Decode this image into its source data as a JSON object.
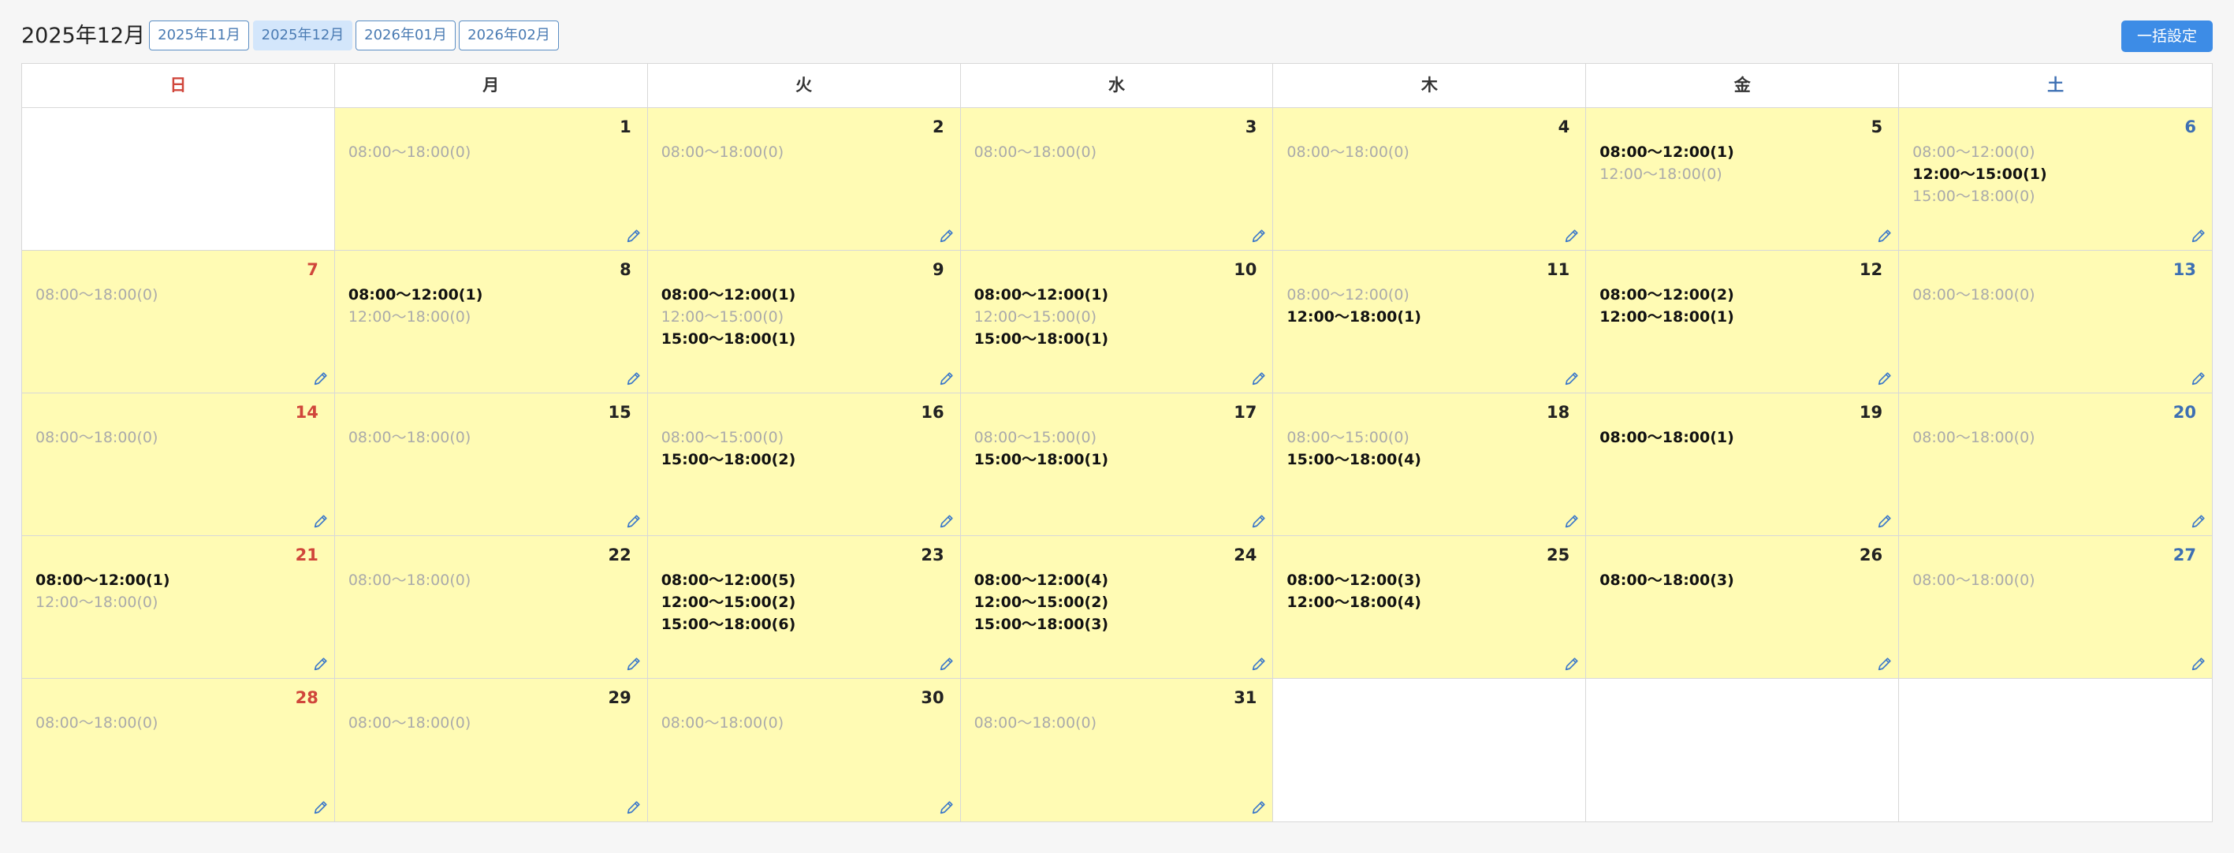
{
  "header": {
    "title": "2025年12月",
    "months": [
      {
        "label": "2025年11月",
        "active": false
      },
      {
        "label": "2025年12月",
        "active": true
      },
      {
        "label": "2026年01月",
        "active": false
      },
      {
        "label": "2026年02月",
        "active": false
      }
    ],
    "bulk_label": "一括設定"
  },
  "colors": {
    "sunday": "#d0463b",
    "saturday": "#3d6fb3",
    "active_day": "#fffbb4",
    "accent": "#3d8ce6",
    "unavailable": "#aaaaaa"
  },
  "weekdays": [
    "日",
    "月",
    "火",
    "水",
    "木",
    "金",
    "土"
  ],
  "leading_blanks": 1,
  "trailing_blanks": 3,
  "days": [
    {
      "day": "1",
      "slots": [
        {
          "text": "08:00〜18:00(0)",
          "on": false
        }
      ]
    },
    {
      "day": "2",
      "slots": [
        {
          "text": "08:00〜18:00(0)",
          "on": false
        }
      ]
    },
    {
      "day": "3",
      "slots": [
        {
          "text": "08:00〜18:00(0)",
          "on": false
        }
      ]
    },
    {
      "day": "4",
      "slots": [
        {
          "text": "08:00〜18:00(0)",
          "on": false
        }
      ]
    },
    {
      "day": "5",
      "slots": [
        {
          "text": "08:00〜12:00(1)",
          "on": true
        },
        {
          "text": "12:00〜18:00(0)",
          "on": false
        }
      ]
    },
    {
      "day": "6",
      "slots": [
        {
          "text": "08:00〜12:00(0)",
          "on": false
        },
        {
          "text": "12:00〜15:00(1)",
          "on": true
        },
        {
          "text": "15:00〜18:00(0)",
          "on": false
        }
      ]
    },
    {
      "day": "7",
      "slots": [
        {
          "text": "08:00〜18:00(0)",
          "on": false
        }
      ]
    },
    {
      "day": "8",
      "slots": [
        {
          "text": "08:00〜12:00(1)",
          "on": true
        },
        {
          "text": "12:00〜18:00(0)",
          "on": false
        }
      ]
    },
    {
      "day": "9",
      "slots": [
        {
          "text": "08:00〜12:00(1)",
          "on": true
        },
        {
          "text": "12:00〜15:00(0)",
          "on": false
        },
        {
          "text": "15:00〜18:00(1)",
          "on": true
        }
      ]
    },
    {
      "day": "10",
      "slots": [
        {
          "text": "08:00〜12:00(1)",
          "on": true
        },
        {
          "text": "12:00〜15:00(0)",
          "on": false
        },
        {
          "text": "15:00〜18:00(1)",
          "on": true
        }
      ]
    },
    {
      "day": "11",
      "slots": [
        {
          "text": "08:00〜12:00(0)",
          "on": false
        },
        {
          "text": "12:00〜18:00(1)",
          "on": true
        }
      ]
    },
    {
      "day": "12",
      "slots": [
        {
          "text": "08:00〜12:00(2)",
          "on": true
        },
        {
          "text": "12:00〜18:00(1)",
          "on": true
        }
      ]
    },
    {
      "day": "13",
      "slots": [
        {
          "text": "08:00〜18:00(0)",
          "on": false
        }
      ]
    },
    {
      "day": "14",
      "slots": [
        {
          "text": "08:00〜18:00(0)",
          "on": false
        }
      ]
    },
    {
      "day": "15",
      "slots": [
        {
          "text": "08:00〜18:00(0)",
          "on": false
        }
      ]
    },
    {
      "day": "16",
      "slots": [
        {
          "text": "08:00〜15:00(0)",
          "on": false
        },
        {
          "text": "15:00〜18:00(2)",
          "on": true
        }
      ]
    },
    {
      "day": "17",
      "slots": [
        {
          "text": "08:00〜15:00(0)",
          "on": false
        },
        {
          "text": "15:00〜18:00(1)",
          "on": true
        }
      ]
    },
    {
      "day": "18",
      "slots": [
        {
          "text": "08:00〜15:00(0)",
          "on": false
        },
        {
          "text": "15:00〜18:00(4)",
          "on": true
        }
      ]
    },
    {
      "day": "19",
      "slots": [
        {
          "text": "08:00〜18:00(1)",
          "on": true
        }
      ]
    },
    {
      "day": "20",
      "slots": [
        {
          "text": "08:00〜18:00(0)",
          "on": false
        }
      ]
    },
    {
      "day": "21",
      "slots": [
        {
          "text": "08:00〜12:00(1)",
          "on": true
        },
        {
          "text": "12:00〜18:00(0)",
          "on": false
        }
      ]
    },
    {
      "day": "22",
      "slots": [
        {
          "text": "08:00〜18:00(0)",
          "on": false
        }
      ]
    },
    {
      "day": "23",
      "slots": [
        {
          "text": "08:00〜12:00(5)",
          "on": true
        },
        {
          "text": "12:00〜15:00(2)",
          "on": true
        },
        {
          "text": "15:00〜18:00(6)",
          "on": true
        }
      ]
    },
    {
      "day": "24",
      "slots": [
        {
          "text": "08:00〜12:00(4)",
          "on": true
        },
        {
          "text": "12:00〜15:00(2)",
          "on": true
        },
        {
          "text": "15:00〜18:00(3)",
          "on": true
        }
      ]
    },
    {
      "day": "25",
      "slots": [
        {
          "text": "08:00〜12:00(3)",
          "on": true
        },
        {
          "text": "12:00〜18:00(4)",
          "on": true
        }
      ]
    },
    {
      "day": "26",
      "slots": [
        {
          "text": "08:00〜18:00(3)",
          "on": true
        }
      ]
    },
    {
      "day": "27",
      "slots": [
        {
          "text": "08:00〜18:00(0)",
          "on": false
        }
      ]
    },
    {
      "day": "28",
      "slots": [
        {
          "text": "08:00〜18:00(0)",
          "on": false
        }
      ]
    },
    {
      "day": "29",
      "slots": [
        {
          "text": "08:00〜18:00(0)",
          "on": false
        }
      ]
    },
    {
      "day": "30",
      "slots": [
        {
          "text": "08:00〜18:00(0)",
          "on": false
        }
      ]
    },
    {
      "day": "31",
      "slots": [
        {
          "text": "08:00〜18:00(0)",
          "on": false
        }
      ]
    }
  ]
}
